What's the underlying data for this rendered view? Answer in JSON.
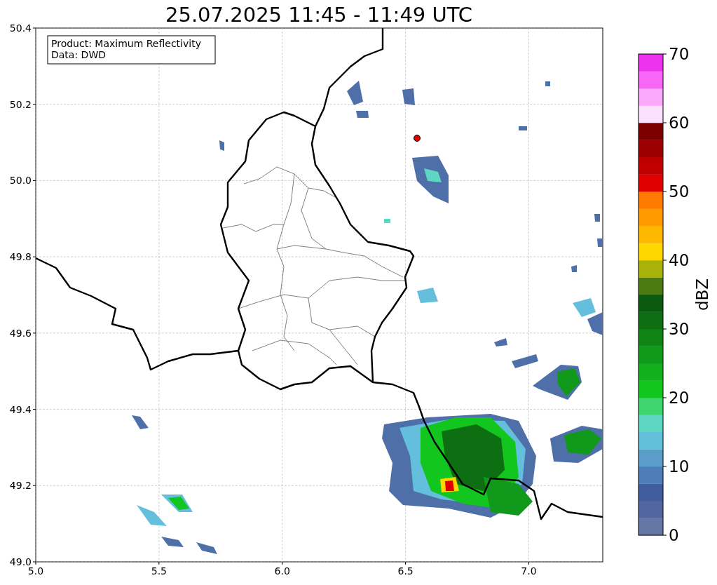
{
  "title": "25.07.2025 11:45 - 11:49 UTC",
  "info_box": {
    "lines": [
      "Product: Maximum Reflectivity",
      "Data: DWD"
    ]
  },
  "x_axis": {
    "ticks": [
      "5.0",
      "5.5",
      "6.0",
      "6.5",
      "7.0"
    ]
  },
  "y_axis": {
    "ticks": [
      "50.4",
      "50.2",
      "50.0",
      "49.8",
      "49.6",
      "49.4",
      "49.2",
      "49.0"
    ]
  },
  "colorbar": {
    "label": "dBZ",
    "ticks": [
      "70",
      "60",
      "50",
      "40",
      "30",
      "20",
      "10",
      "0"
    ],
    "bins": [
      {
        "color": "#6577a5"
      },
      {
        "color": "#51669f"
      },
      {
        "color": "#405da0"
      },
      {
        "color": "#4e7db7"
      },
      {
        "color": "#5b9dcb"
      },
      {
        "color": "#63bfdc"
      },
      {
        "color": "#5ed6c4"
      },
      {
        "color": "#3fd46e"
      },
      {
        "color": "#13c51f"
      },
      {
        "color": "#11b01c"
      },
      {
        "color": "#10991a"
      },
      {
        "color": "#0f8415"
      },
      {
        "color": "#0e6e12"
      },
      {
        "color": "#0b5a10"
      },
      {
        "color": "#4c7a10"
      },
      {
        "color": "#aab20a"
      },
      {
        "color": "#ffd700"
      },
      {
        "color": "#ffb800"
      },
      {
        "color": "#ff9a00"
      },
      {
        "color": "#ff7b00"
      },
      {
        "color": "#e00000"
      },
      {
        "color": "#c00000"
      },
      {
        "color": "#9c0000"
      },
      {
        "color": "#7a0000"
      },
      {
        "color": "#fde0fd"
      },
      {
        "color": "#fbaafb"
      },
      {
        "color": "#f866f8"
      },
      {
        "color": "#ee33ee"
      }
    ]
  }
}
